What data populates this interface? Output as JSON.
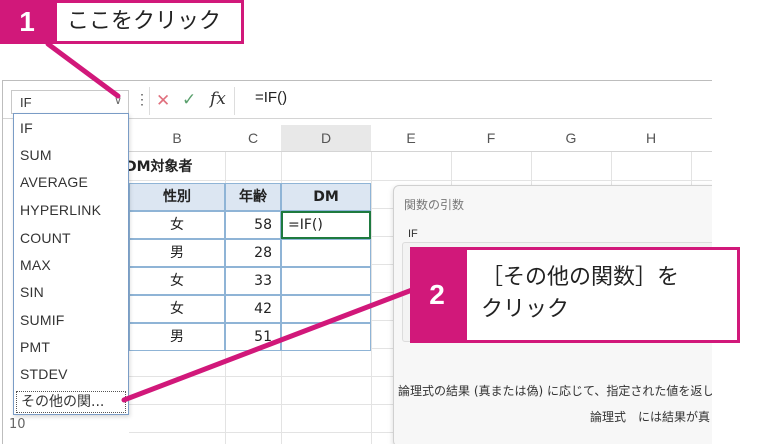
{
  "callouts": {
    "step1": {
      "number": "1",
      "text": "ここをクリック"
    },
    "step2": {
      "number": "2",
      "line1": "［その他の関数］を",
      "line2": "クリック"
    }
  },
  "formula_bar": {
    "name_box": "IF",
    "dots": "⋮",
    "cancel_glyph": "✕",
    "enter_glyph": "✓",
    "fx_label": "fx",
    "formula": "=IF()"
  },
  "columns": [
    "B",
    "C",
    "D",
    "E",
    "F",
    "G",
    "H"
  ],
  "sheet": {
    "title": "DM対象者",
    "headers": [
      "性別",
      "年齢",
      "DM"
    ],
    "rows": [
      {
        "gender": "女",
        "age": "58",
        "dm": "=IF()"
      },
      {
        "gender": "男",
        "age": "28",
        "dm": ""
      },
      {
        "gender": "女",
        "age": "33",
        "dm": ""
      },
      {
        "gender": "女",
        "age": "42",
        "dm": ""
      },
      {
        "gender": "男",
        "age": "51",
        "dm": ""
      }
    ],
    "row_label_bottom": "10"
  },
  "function_dropdown": {
    "items": [
      "IF",
      "SUM",
      "AVERAGE",
      "HYPERLINK",
      "COUNT",
      "MAX",
      "SIN",
      "SUMIF",
      "PMT",
      "STDEV"
    ],
    "more": "その他の関..."
  },
  "dialog": {
    "title": "関数の引数",
    "function_name": "IF",
    "description": "論理式の結果 (真または偽) に応じて、指定された値を返し",
    "arg_description": "論理式　には結果が真ま"
  },
  "colors": {
    "accent": "#d1187a",
    "excel_green": "#1e7a3f",
    "table_header": "#dce6f2"
  }
}
